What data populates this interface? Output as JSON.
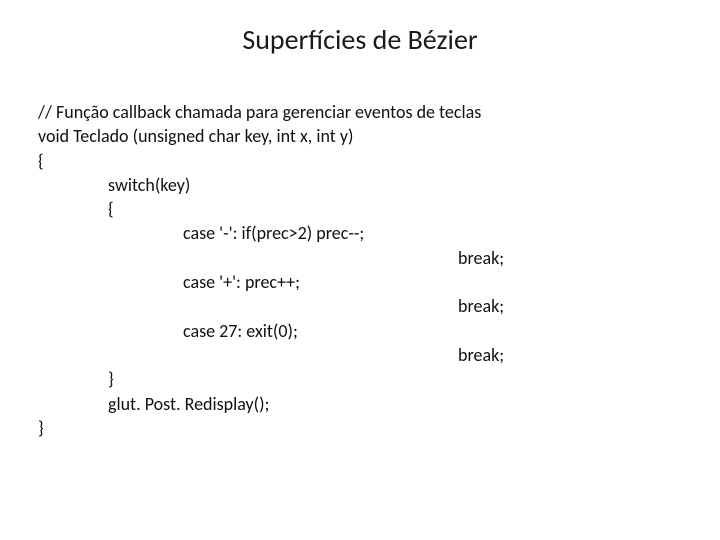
{
  "title": "Superfícies de Bézier",
  "code": {
    "l1": "// Função callback chamada para gerenciar eventos de teclas",
    "l2": "void Teclado (unsigned char key, int x, int y)",
    "l3": "{",
    "l4": "switch(key)",
    "l5": "{",
    "l6": "case '-':  if(prec>2)  prec--;",
    "l7": "break;",
    "l8": "case '+':  prec++;",
    "l9": "break;",
    "l10": "case 27: exit(0);",
    "l11": "break;",
    "l12": "}",
    "l13": "glut. Post. Redisplay();",
    "l14": "}"
  }
}
